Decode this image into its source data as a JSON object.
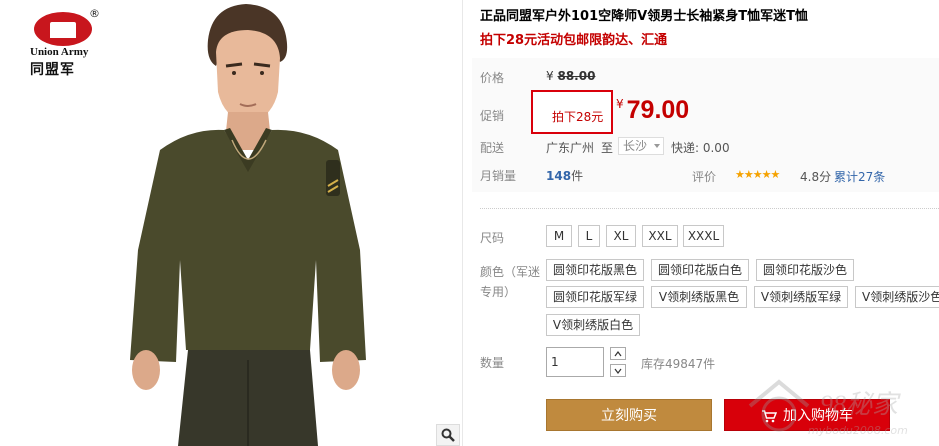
{
  "brand": {
    "name_en": "Union Army",
    "name_cn": "同盟军",
    "reg_mark": "®"
  },
  "product": {
    "title": "正品同盟军户外101空降师V领男士长袖紧身T恤军迷T恤",
    "subtitle": "拍下28元活动包邮限韵达、汇通"
  },
  "price": {
    "label": "价格",
    "currency": "¥",
    "original": "88.00",
    "promo_label": "促销",
    "promo_tag": "拍下28元",
    "promo_currency": "¥",
    "promo": "79.00"
  },
  "shipping": {
    "label": "配送",
    "from": "广东广州",
    "to_word": "至",
    "destination": "长沙",
    "delivery": "快递: 0.00"
  },
  "sales": {
    "label": "月销量",
    "count": "148",
    "unit": "件",
    "rating_label": "评价",
    "stars": "★★★★★",
    "score": "4.8分",
    "reviews": "累计27条"
  },
  "size": {
    "label": "尺码",
    "options": [
      "M",
      "L",
      "XL",
      "XXL",
      "XXXL"
    ]
  },
  "color": {
    "label": "颜色（军迷专用）",
    "options": [
      "圆领印花版黑色",
      "圆领印花版白色",
      "圆领印花版沙色",
      "圆领印花版军绿",
      "V领刺绣版黑色",
      "V领刺绣版军绿",
      "V领刺绣版沙色",
      "V领刺绣版白色"
    ]
  },
  "quantity": {
    "label": "数量",
    "value": "1",
    "stock": "库存49847件"
  },
  "actions": {
    "buy_now": "立刻购买",
    "add_cart": "加入购物车"
  },
  "watermark": {
    "text": "98秘家",
    "url": "mybodu2008.com"
  },
  "icons": {
    "zoom": "magnifier-icon",
    "cart": "cart-icon",
    "up": "chevron-up-icon",
    "down": "chevron-down-icon"
  },
  "colors": {
    "accent_red": "#c40000",
    "buy_brown": "#c08a3e",
    "cart_red": "#d8000a",
    "star": "#f5a200",
    "link_blue": "#3366aa",
    "shirt_olive": "#4a4a2c"
  }
}
